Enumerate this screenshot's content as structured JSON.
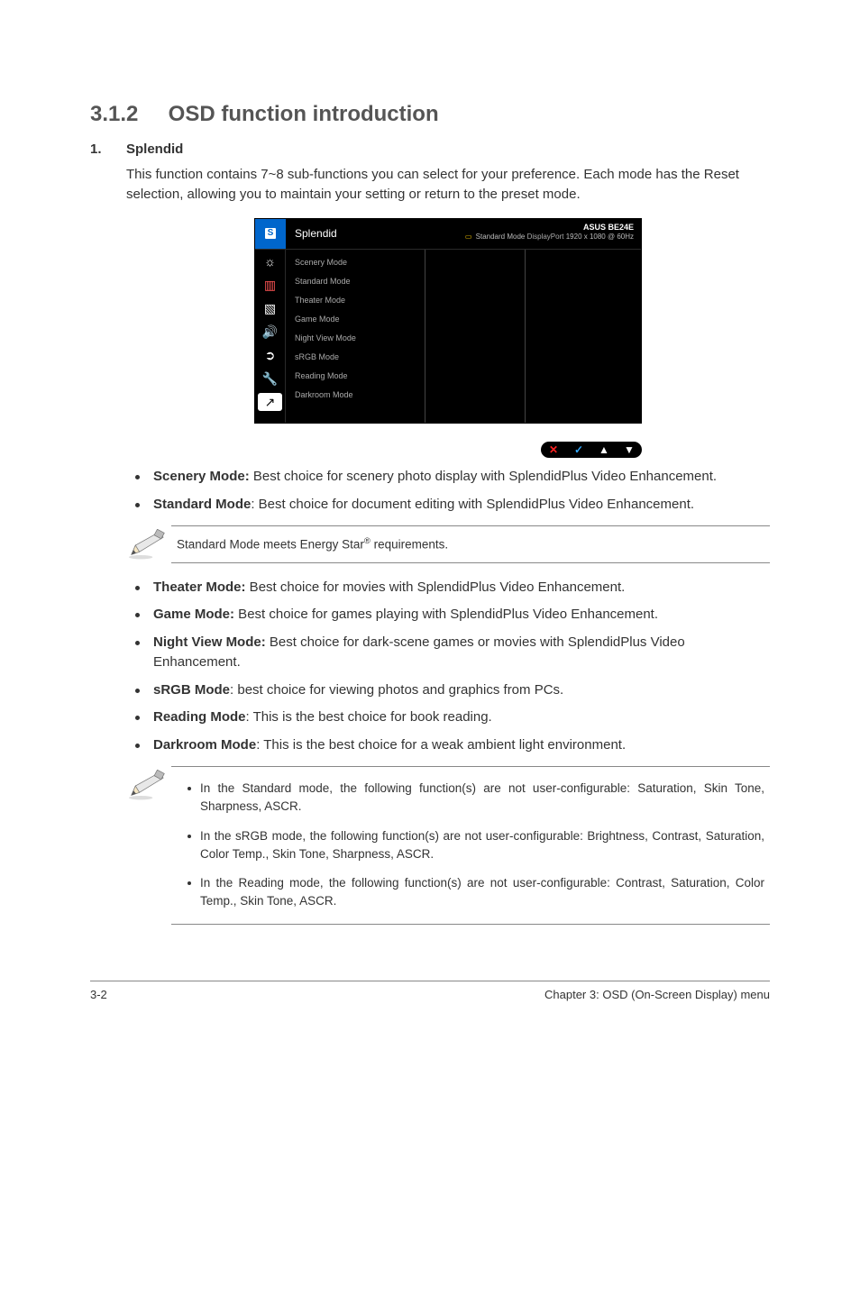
{
  "section": {
    "number": "3.1.2",
    "title": "OSD function introduction"
  },
  "item1": {
    "num": "1.",
    "heading": "Splendid",
    "intro": "This function contains 7~8 sub-functions you can select for your preference. Each mode has the Reset selection, allowing you to maintain your setting or return to the preset mode."
  },
  "osd": {
    "icon_letter": "S",
    "title": "Splendid",
    "model": "ASUS BE24E",
    "mode_label": "Standard Mode",
    "port": "DisplayPort",
    "res": "1920 x 1080 @ 60Hz",
    "menu": [
      "Scenery Mode",
      "Standard Mode",
      "Theater Mode",
      "Game Mode",
      "Night View Mode",
      "sRGB Mode",
      "Reading Mode",
      "Darkroom Mode"
    ],
    "side_icons": [
      "☼",
      "▥",
      "▧",
      "🔊",
      "➲",
      "🔧",
      "↗"
    ],
    "ctrl_icons": [
      "✕",
      "✓",
      "▲",
      "▼"
    ]
  },
  "bullets_a": [
    {
      "b": "Scenery Mode:",
      "t": " Best choice for scenery photo display with SplendidPlus Video Enhancement."
    },
    {
      "b": "Standard Mode",
      "t": ": Best choice for document editing with SplendidPlus Video Enhancement."
    }
  ],
  "note1": {
    "text_pre": "Standard Mode meets Energy Star",
    "text_post": " requirements."
  },
  "bullets_b": [
    {
      "b": "Theater Mode:",
      "t": " Best choice for movies with SplendidPlus Video Enhancement."
    },
    {
      "b": "Game Mode:",
      "t": " Best choice for games playing with SplendidPlus Video Enhancement."
    },
    {
      "b": "Night View Mode:",
      "t": " Best choice for dark-scene games or movies with SplendidPlus Video Enhancement."
    },
    {
      "b": "sRGB Mode",
      "t": ": best choice for viewing photos and graphics from PCs."
    },
    {
      "b": "Reading Mode",
      "t": ": This is the best choice for book reading."
    },
    {
      "b": "Darkroom Mode",
      "t": ": This is the best choice for a weak ambient light environment."
    }
  ],
  "note2": {
    "items": [
      "In the Standard mode, the following function(s) are not user-configurable: Saturation, Skin Tone, Sharpness, ASCR.",
      "In the sRGB mode, the following function(s) are not user-configurable: Brightness, Contrast, Saturation, Color Temp., Skin Tone, Sharpness, ASCR.",
      "In the Reading mode, the following function(s) are not user-configurable: Contrast, Saturation, Color Temp., Skin Tone, ASCR."
    ]
  },
  "footer": {
    "left": "3-2",
    "right": "Chapter 3: OSD (On-Screen Display) menu"
  }
}
